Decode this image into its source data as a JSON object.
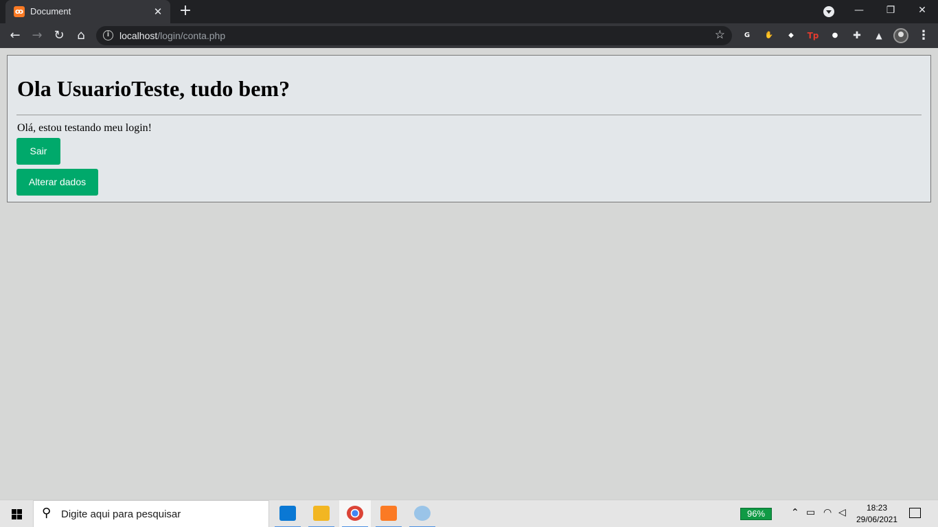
{
  "browser": {
    "tab": {
      "title": "Document",
      "close_glyph": "✕"
    },
    "new_tab_glyph": "+",
    "window_controls": {
      "minimize": "—",
      "restore": "❐",
      "close": "✕"
    },
    "nav": {
      "back": "←",
      "forward": "→",
      "reload": "↻",
      "home": "⌂"
    },
    "address": {
      "host": "localhost",
      "path": "/login/conta.php",
      "info_glyph": "i",
      "star_glyph": "☆"
    },
    "menu_glyph": "⋮",
    "extensions": [
      {
        "name": "grammarly",
        "glyph": "G",
        "color": "#15c39a"
      },
      {
        "name": "adblock",
        "glyph": "✋",
        "color": "#d8262b"
      },
      {
        "name": "extension-diamond",
        "glyph": "◆",
        "color": "#1e6fd9"
      },
      {
        "name": "tp",
        "glyph": "Tp",
        "color": "transparent"
      },
      {
        "name": "video-recorder",
        "glyph": "●",
        "color": "#23c16b"
      },
      {
        "name": "puzzle",
        "glyph": "✚",
        "color": "transparent"
      },
      {
        "name": "labs",
        "glyph": "▲",
        "color": "transparent"
      }
    ]
  },
  "page": {
    "greeting": "Ola UsuarioTeste, tudo bem?",
    "message": "Olá, estou testando meu login!",
    "buttons": {
      "logout": "Sair",
      "edit": "Alterar dados"
    },
    "colors": {
      "button": "#00a96b",
      "card": "#e3e7ea",
      "background": "#d6d7d6"
    }
  },
  "taskbar": {
    "search_placeholder": "Digite aqui para pesquisar",
    "apps": [
      {
        "name": "mail",
        "color": "#0a78d4",
        "active": false
      },
      {
        "name": "file-explorer",
        "color": "#f2b622",
        "active": false
      },
      {
        "name": "chrome",
        "color": "#db4437",
        "active": true
      },
      {
        "name": "xampp",
        "color": "#fb7a24",
        "active": false
      },
      {
        "name": "paint",
        "color": "#9ac4e8",
        "active": false
      }
    ],
    "battery": "96%",
    "time": "18:23",
    "date": "29/06/2021"
  }
}
